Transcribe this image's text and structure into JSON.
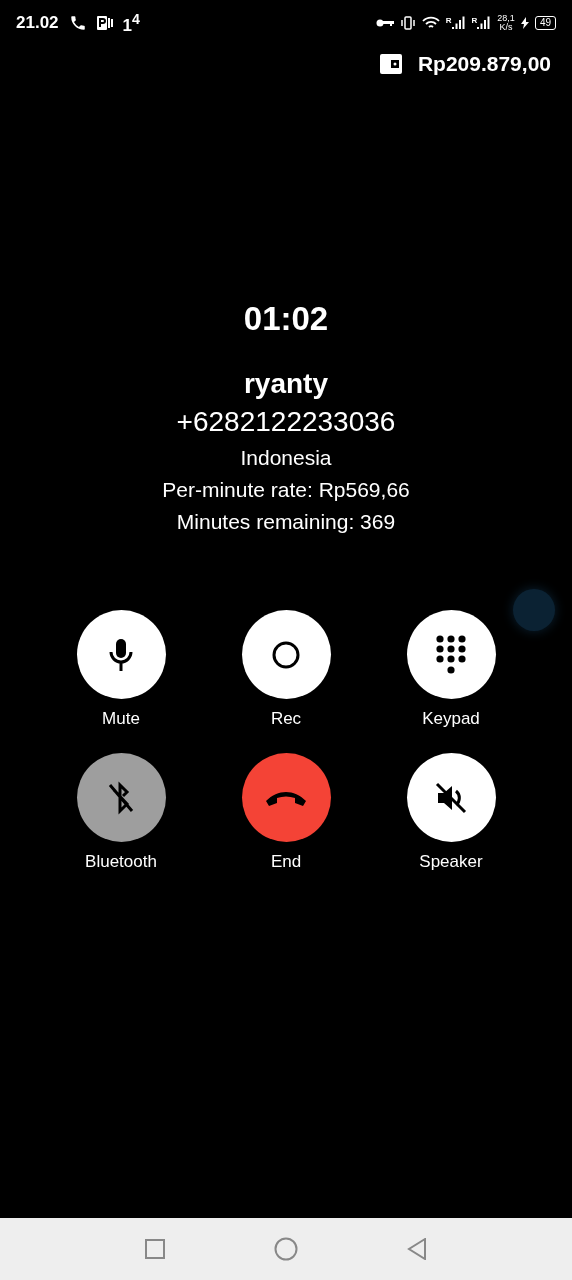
{
  "status_bar": {
    "time": "21.02",
    "notification": "1$^{4}$",
    "signals": [
      {
        "label": "R"
      },
      {
        "label": "R"
      }
    ],
    "speed": "28,1",
    "speed_unit": "K/s",
    "battery": "49"
  },
  "balance": "Rp209.879,00",
  "call": {
    "timer": "01:02",
    "name": "ryanty",
    "number": "+6282122233036",
    "country": "Indonesia",
    "rate": "Per-minute rate: Rp569,66",
    "remaining": "Minutes remaining: 369"
  },
  "controls": [
    {
      "kind": "mic",
      "label": "Mute",
      "disabled": false
    },
    {
      "kind": "rec",
      "label": "Rec",
      "disabled": false
    },
    {
      "kind": "keypad",
      "label": "Keypad",
      "disabled": false
    },
    {
      "kind": "bluetooth",
      "label": "Bluetooth",
      "disabled": true
    },
    {
      "kind": "end",
      "label": "End",
      "disabled": false
    },
    {
      "kind": "speaker",
      "label": "Speaker",
      "disabled": false
    }
  ]
}
